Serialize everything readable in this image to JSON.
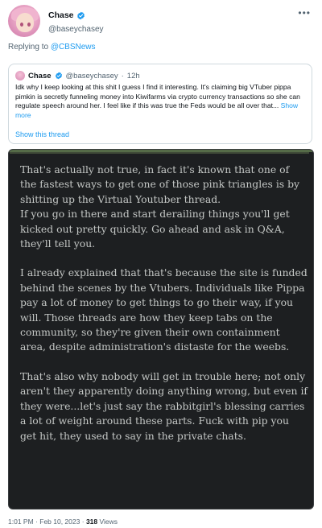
{
  "tweet": {
    "author": {
      "display_name": "Chase",
      "handle": "@baseychasey",
      "verified": true
    },
    "more_icon": "more-horizontal-icon",
    "replying_to_prefix": "Replying to",
    "replying_to_handle": "@CBSNews",
    "quoted": {
      "display_name": "Chase",
      "handle": "@baseychasey",
      "separator": "·",
      "time": "12h",
      "text": "Idk why I keep looking at this shit I guess I find it interesting. It's claiming big VTuber pippa pimkin is secretly funneling money into Kiwifarms via crypto currency transactions so she can regulate speech around her. I feel like if this was true the Feds would be all over that...",
      "show_more": "Show more",
      "show_thread": "Show this thread"
    },
    "image_text": [
      "That's actually not true, in fact it's known that one of the fastest ways to get one of those pink triangles is by shitting up the Virtual Youtuber thread.\nIf you go in there and start derailing things you'll get kicked out pretty quickly. Go ahead and ask in Q&A, they'll tell you.",
      "I already explained that that's because the site is funded behind the scenes by the Vtubers. Individuals like Pippa pay a lot of money to get things to go their way, if you will. Those threads are how they keep tabs on the community, so they're given their own containment area, despite administration's distaste for the weebs.",
      "That's also why nobody will get in trouble here; not only aren't they apparently doing anything wrong, but even if they were...let's just say the rabbitgirl's blessing carries a lot of weight around these parts. Fuck with pip you get hit, they used to say in the private chats."
    ],
    "footer": {
      "time": "1:01 PM",
      "separator": "·",
      "date": "Feb 10, 2023",
      "separator2": "·",
      "views_count": "318",
      "views_label": "Views"
    },
    "colors": {
      "accent": "#1d9bf0",
      "muted": "#536471",
      "image_bg": "#1d1f21",
      "image_text": "#c5c8c6"
    }
  }
}
